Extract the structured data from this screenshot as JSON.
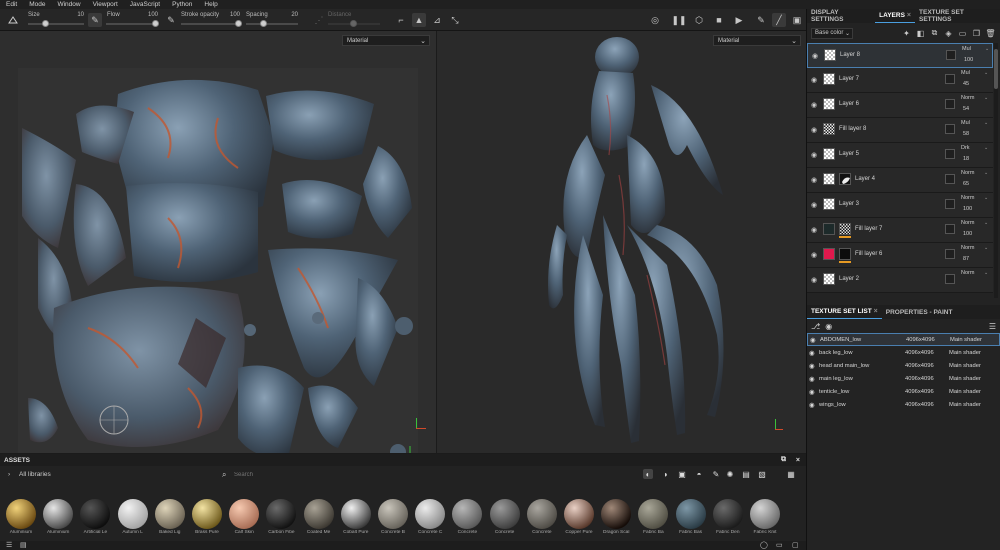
{
  "menu": [
    "Edit",
    "Mode",
    "Window",
    "Viewport",
    "JavaScript",
    "Python",
    "Help"
  ],
  "toolbar": {
    "size_label": "Size",
    "size_value": "10",
    "flow_label": "Flow",
    "flow_value": "100",
    "stroke_opacity_label": "Stroke opacity",
    "stroke_opacity_value": "100",
    "spacing_label": "Spacing",
    "spacing_value": "20",
    "distance_label": "Distance"
  },
  "viewport": {
    "left_mode": "Material",
    "right_mode": "Material"
  },
  "right_panel": {
    "tabs": [
      "DISPLAY SETTINGS",
      "LAYERS",
      "TEXTURE SET SETTINGS"
    ],
    "active_tab": "LAYERS",
    "channel": "Base color",
    "layers": [
      {
        "name": "Layer 8",
        "blend": "Mul",
        "opacity": "100",
        "selected": true,
        "kind": "paint"
      },
      {
        "name": "Layer 7",
        "blend": "Mul",
        "opacity": "45",
        "kind": "paint"
      },
      {
        "name": "Layer 6",
        "blend": "Norm",
        "opacity": "54",
        "kind": "paint"
      },
      {
        "name": "Fill layer 8",
        "blend": "Mul",
        "opacity": "58",
        "kind": "fill"
      },
      {
        "name": "Layer 5",
        "blend": "Drk",
        "opacity": "18",
        "kind": "paint"
      },
      {
        "name": "Layer 4",
        "blend": "Norm",
        "opacity": "65",
        "kind": "masked"
      },
      {
        "name": "Layer 3",
        "blend": "Norm",
        "opacity": "100",
        "kind": "paint"
      },
      {
        "name": "Fill layer 7",
        "blend": "Norm",
        "opacity": "100",
        "kind": "fill-dark"
      },
      {
        "name": "Fill layer 6",
        "blend": "Norm",
        "opacity": "87",
        "kind": "fill-red"
      },
      {
        "name": "Layer 2",
        "blend": "Norm",
        "opacity": "",
        "kind": "paint"
      }
    ]
  },
  "texture_set": {
    "tabs": [
      "TEXTURE SET LIST",
      "PROPERTIES - PAINT"
    ],
    "rows": [
      {
        "name": "ABDOMEN_low",
        "res": "4096x4096",
        "shader": "Main shader",
        "selected": true
      },
      {
        "name": "back leg_low",
        "res": "4096x4096",
        "shader": "Main shader"
      },
      {
        "name": "head and main_low",
        "res": "4096x4096",
        "shader": "Main shader"
      },
      {
        "name": "main leg_low",
        "res": "4096x4096",
        "shader": "Main shader"
      },
      {
        "name": "tenticle_low",
        "res": "4096x4096",
        "shader": "Main shader"
      },
      {
        "name": "wings_low",
        "res": "4096x4096",
        "shader": "Main shader"
      }
    ]
  },
  "assets": {
    "title": "ASSETS",
    "library": "All libraries",
    "search_placeholder": "Search",
    "materials": [
      {
        "label": "Aluminium",
        "c1": "#f1d27a",
        "c2": "#6b4a12"
      },
      {
        "label": "Aluminium",
        "c1": "#e6e6e6",
        "c2": "#4a4a4a"
      },
      {
        "label": "Artificial Le",
        "c1": "#555555",
        "c2": "#0e0e0e"
      },
      {
        "label": "Autumn L",
        "c1": "#f2f2f2",
        "c2": "#a4a4a4"
      },
      {
        "label": "Baked Lig",
        "c1": "#ded4b9",
        "c2": "#6b6354"
      },
      {
        "label": "Brass Pure",
        "c1": "#f3e3a3",
        "c2": "#6e5a1c"
      },
      {
        "label": "Calf Skin",
        "c1": "#f6c9b0",
        "c2": "#a86d55"
      },
      {
        "label": "Carbon Fibe",
        "c1": "#6a6a6a",
        "c2": "#121212"
      },
      {
        "label": "Coated Me",
        "c1": "#a8a295",
        "c2": "#3e3a33"
      },
      {
        "label": "Cobalt Pure",
        "c1": "#f0f0f0",
        "c2": "#3c3c3c"
      },
      {
        "label": "Concrete B",
        "c1": "#c9c5bb",
        "c2": "#67635b"
      },
      {
        "label": "Concrete C",
        "c1": "#ececec",
        "c2": "#8a8a8a"
      },
      {
        "label": "Concrete",
        "c1": "#b7b7b7",
        "c2": "#5a5a5a"
      },
      {
        "label": "Concrete",
        "c1": "#9a9a9a",
        "c2": "#3e3e3e"
      },
      {
        "label": "Concrete",
        "c1": "#a9a69f",
        "c2": "#4f4c46"
      },
      {
        "label": "Copper Pure",
        "c1": "#e9d0c5",
        "c2": "#5a3a2c"
      },
      {
        "label": "Dragon Scal",
        "c1": "#a08878",
        "c2": "#150c08"
      },
      {
        "label": "Fabric Ba",
        "c1": "#a9a798",
        "c2": "#514f44"
      },
      {
        "label": "Fabric Bas",
        "c1": "#7d97a6",
        "c2": "#2b3c46"
      },
      {
        "label": "Fabric Den",
        "c1": "#6a6a6a",
        "c2": "#1c1c1c"
      },
      {
        "label": "Fabric Knit",
        "c1": "#d4d4d4",
        "c2": "#6a6a6a"
      }
    ]
  }
}
